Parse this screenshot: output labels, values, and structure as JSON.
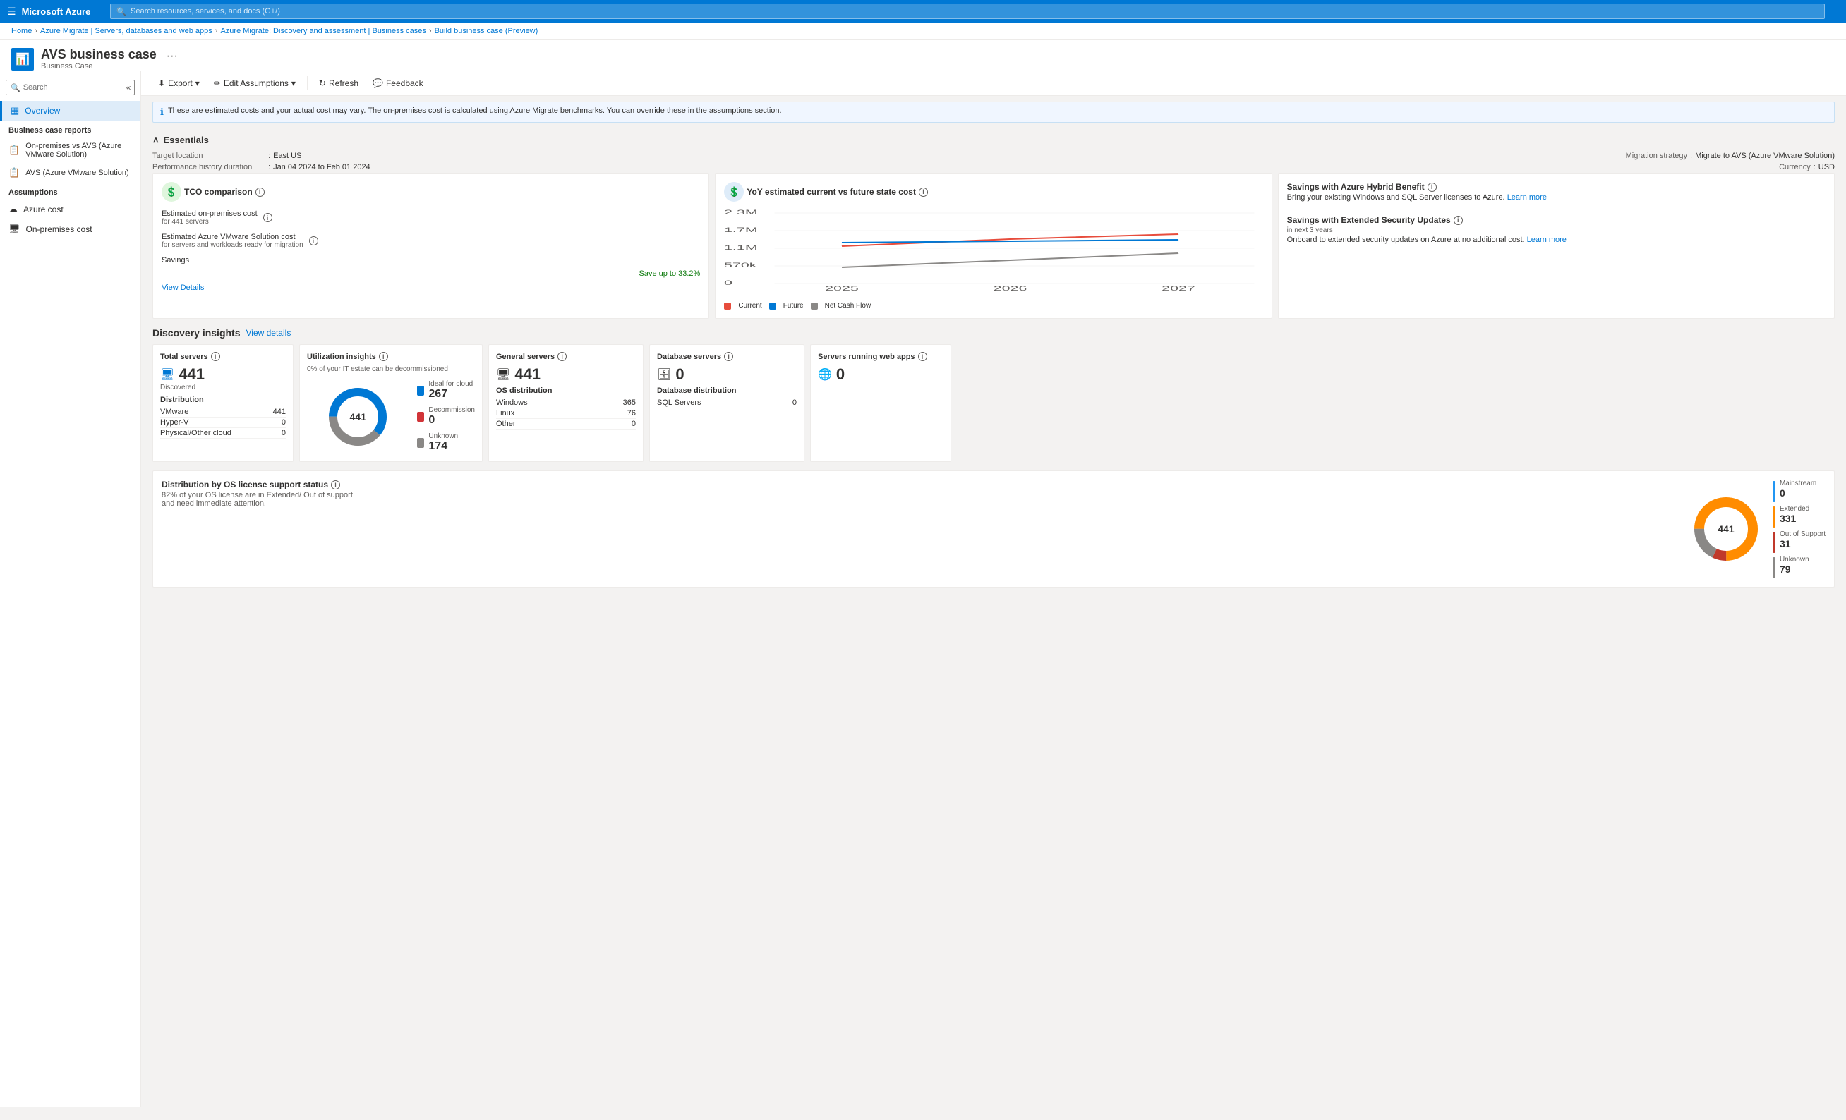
{
  "topbar": {
    "title": "Microsoft Azure",
    "search_placeholder": "Search resources, services, and docs (G+/)"
  },
  "breadcrumb": {
    "items": [
      "Home",
      "Azure Migrate | Servers, databases and web apps",
      "Azure Migrate: Discovery and assessment | Business cases",
      "Build business case (Preview)"
    ]
  },
  "page": {
    "title": "AVS business case",
    "subtitle": "Business Case",
    "more_icon": "···"
  },
  "toolbar": {
    "export_label": "Export",
    "edit_assumptions_label": "Edit Assumptions",
    "refresh_label": "Refresh",
    "feedback_label": "Feedback"
  },
  "info_bar": {
    "text": "These are estimated costs and your actual cost may vary. The on-premises cost is calculated using Azure Migrate benchmarks. You can override these in the assumptions section."
  },
  "sidebar": {
    "search_placeholder": "Search",
    "items": [
      {
        "id": "overview",
        "label": "Overview",
        "icon": "▦",
        "active": true
      },
      {
        "id": "section_reports",
        "label": "Business case reports",
        "section": true
      },
      {
        "id": "on-prem-avs",
        "label": "On-premises vs AVS (Azure VMware Solution)",
        "icon": "📋"
      },
      {
        "id": "avs",
        "label": "AVS (Azure VMware Solution)",
        "icon": "📋"
      },
      {
        "id": "section_assumptions",
        "label": "Assumptions",
        "section": true
      },
      {
        "id": "azure-cost",
        "label": "Azure cost",
        "icon": "☁"
      },
      {
        "id": "on-prem-cost",
        "label": "On-premises cost",
        "icon": "🖥"
      }
    ]
  },
  "essentials": {
    "title": "Essentials",
    "target_location_label": "Target location",
    "target_location_value": "East US",
    "perf_history_label": "Performance history duration",
    "perf_history_value": "Jan 04 2024 to Feb 01 2024",
    "migration_strategy_label": "Migration strategy",
    "migration_strategy_value": "Migrate to AVS (Azure VMware Solution)",
    "currency_label": "Currency",
    "currency_value": "USD"
  },
  "tco": {
    "title": "TCO comparison",
    "on_prem_label": "Estimated on-premises cost",
    "on_prem_sub": "for 441 servers",
    "avs_label": "Estimated Azure VMware Solution cost",
    "avs_sub": "for servers and workloads ready for migration",
    "savings_label": "Savings",
    "savings_value": "Save up to 33.2%",
    "view_details": "View Details"
  },
  "yoy": {
    "title": "YoY estimated current vs future state cost",
    "legend": {
      "current": "Current",
      "future": "Future",
      "net_cash_flow": "Net Cash Flow"
    },
    "years": [
      "2025",
      "2026",
      "2027"
    ],
    "y_labels": [
      "2.3M",
      "1.7M",
      "1.1M",
      "570k",
      "0"
    ],
    "current_line_color": "#e74c3c",
    "future_line_color": "#0078d4",
    "net_cash_flow_color": "#8a8886"
  },
  "savings_azure": {
    "title": "Savings with Azure Hybrid Benefit",
    "desc": "Bring your existing Windows and SQL Server licenses to Azure.",
    "learn_more": "Learn more"
  },
  "savings_security": {
    "title": "Savings with Extended Security Updates",
    "sub": "in next 3 years",
    "desc": "Onboard to extended security updates on Azure at no additional cost.",
    "learn_more": "Learn more"
  },
  "discovery": {
    "title": "Discovery insights",
    "view_details": "View details",
    "total_servers": {
      "title": "Total servers",
      "count": "441",
      "label": "Discovered",
      "dist_title": "Distribution",
      "rows": [
        {
          "name": "VMware",
          "value": "441"
        },
        {
          "name": "Hyper-V",
          "value": "0"
        },
        {
          "name": "Physical/Other cloud",
          "value": "0"
        }
      ]
    },
    "utilization": {
      "title": "Utilization insights",
      "subtitle": "0% of your IT estate can be decommissioned",
      "total": "441",
      "items": [
        {
          "label": "Ideal for cloud",
          "value": "267",
          "color": "#0078d4"
        },
        {
          "label": "Decommission",
          "value": "0",
          "color": "#d13438"
        },
        {
          "label": "Unknown",
          "value": "174",
          "color": "#8a8886"
        }
      ]
    },
    "general_servers": {
      "title": "General servers",
      "count": "441",
      "os_dist_title": "OS distribution",
      "rows": [
        {
          "name": "Windows",
          "value": "365"
        },
        {
          "name": "Linux",
          "value": "76"
        },
        {
          "name": "Other",
          "value": "0"
        }
      ]
    },
    "database_servers": {
      "title": "Database servers",
      "count": "0",
      "dist_title": "Database distribution",
      "rows": [
        {
          "name": "SQL Servers",
          "value": "0"
        }
      ]
    },
    "web_apps": {
      "title": "Servers running web apps",
      "count": "0"
    }
  },
  "os_license": {
    "title": "Distribution by OS license support status",
    "subtitle": "82% of your OS license are in Extended/ Out of support and need immediate attention.",
    "total": "441",
    "items": [
      {
        "label": "Mainstream",
        "value": "0",
        "color": "#2196F3"
      },
      {
        "label": "Extended",
        "value": "331",
        "color": "#FF8C00"
      },
      {
        "label": "Out of Support",
        "value": "31",
        "color": "#c0392b"
      },
      {
        "label": "Unknown",
        "value": "79",
        "color": "#8a8886"
      }
    ]
  }
}
